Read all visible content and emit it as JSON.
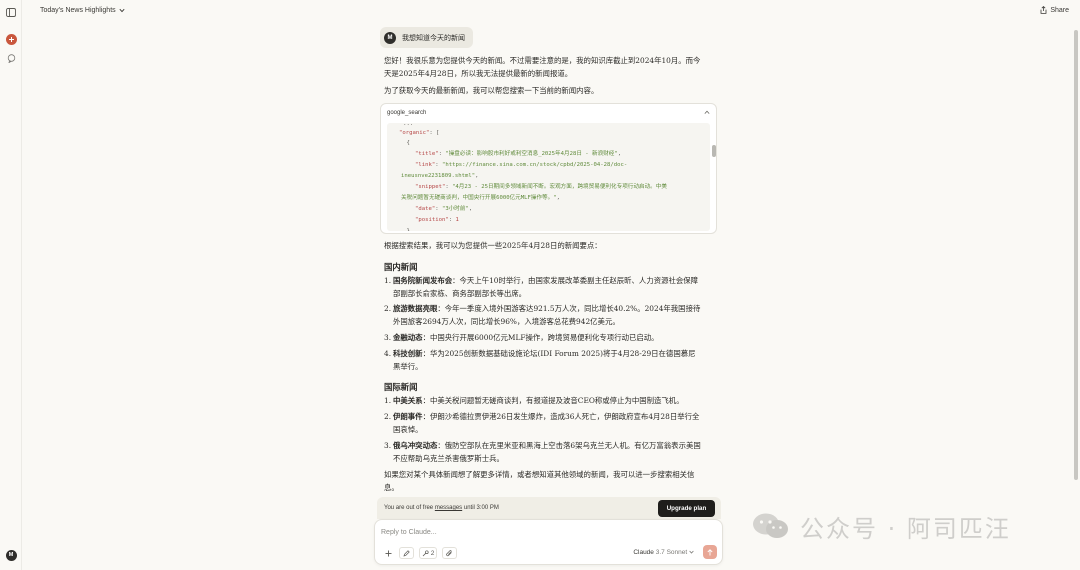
{
  "header": {
    "title": "Today's News Highlights",
    "share_label": "Share"
  },
  "sidebar": {
    "user_initial": "M"
  },
  "user_message": {
    "initial": "M",
    "text": "我想知道今天的新闻"
  },
  "intro": {
    "p1": "您好！我很乐意为您提供今天的新闻。不过需要注意的是，我的知识库截止到2024年10月。而今天是2025年4月28日，所以我无法提供最新的新闻报道。",
    "p2": "为了获取今天的最新新闻，我可以帮您搜索一下当前的新闻内容。"
  },
  "tool": {
    "name": "google_search",
    "code": {
      "line0": "  \"...",
      "organic_key": "\"organic\"",
      "organic_rest": ": [",
      "brace_open": "    {",
      "title_key": "\"title\"",
      "title_val": "\"操盘必读：影响股市利好或利空消息_2025年4月28日 - 新浪财经\"",
      "link_key": "\"link\"",
      "link_val": "\"https://finance.sina.com.cn/stock/cpbd/2025-04-28/doc-",
      "link_val2": "ineusnve2231809.shtml\"",
      "snippet_key": "\"snippet\"",
      "snippet_val": "\"4月23 - 25日期间多领域新闻不断。宏观方面，跨境贸易便利化专项行动启动。中美",
      "snippet_val2": "关税问题暂无磋商谈判，中国央行开展6000亿元MLF操作等。\"",
      "date_key": "\"date\"",
      "date_val": "\"3小时前\"",
      "position_key": "\"position\"",
      "position_val": "1",
      "brace_close": "    },"
    }
  },
  "summary_intro": "根据搜索结果，我可以为您提供一些2025年4月28日的新闻要点：",
  "domestic": {
    "heading": "国内新闻",
    "items": [
      {
        "num": "1.",
        "title": "国务院新闻发布会",
        "text": "：今天上午10时举行，由国家发展改革委副主任赵辰昕、人力资源社会保障部副部长俞家栋、商务部副部长等出席。"
      },
      {
        "num": "2.",
        "title": "旅游数据亮眼",
        "text": "：今年一季度入境外国游客达921.5万人次，同比增长40.2%。2024年我国接待外国旅客2694万人次，同比增长96%，入境游客总花费942亿美元。"
      },
      {
        "num": "3.",
        "title": "金融动态",
        "text": "：中国央行开展6000亿元MLF操作，跨境贸易便利化专项行动已启动。"
      },
      {
        "num": "4.",
        "title": "科技创新",
        "text": "：华为2025创新数据基础设施论坛(IDI Forum 2025)将于4月28-29日在德国慕尼黑举行。"
      }
    ]
  },
  "international": {
    "heading": "国际新闻",
    "items": [
      {
        "num": "1.",
        "title": "中美关系",
        "text": "：中美关税问题暂无磋商谈判，有报道提及波音CEO称或停止为中国制造飞机。"
      },
      {
        "num": "2.",
        "title": "伊朗事件",
        "text": "：伊朗沙希德拉贾伊港26日发生爆炸，造成36人死亡，伊朗政府宣布4月28日举行全国哀悼。"
      },
      {
        "num": "3.",
        "title": "俄乌冲突动态",
        "text": "：俄防空部队在克里米亚和黑海上空击落6架乌克兰无人机。有亿万富翁表示美国不应帮助乌克兰杀害俄罗斯士兵。"
      }
    ]
  },
  "closing": "如果您对某个具体新闻想了解更多详情，或者想知道其他领域的新闻，我可以进一步搜索相关信息。",
  "banner": {
    "text_before": "You are out of free ",
    "link": "messages",
    "text_after": " until 3:00 PM",
    "upgrade_label": "Upgrade plan"
  },
  "input": {
    "placeholder": "Reply to Claude...",
    "tool_count": "2",
    "model_name": "Claude",
    "model_version": "3.7 Sonnet"
  },
  "watermark": {
    "text": "公众号 · 阿司匹汪"
  }
}
